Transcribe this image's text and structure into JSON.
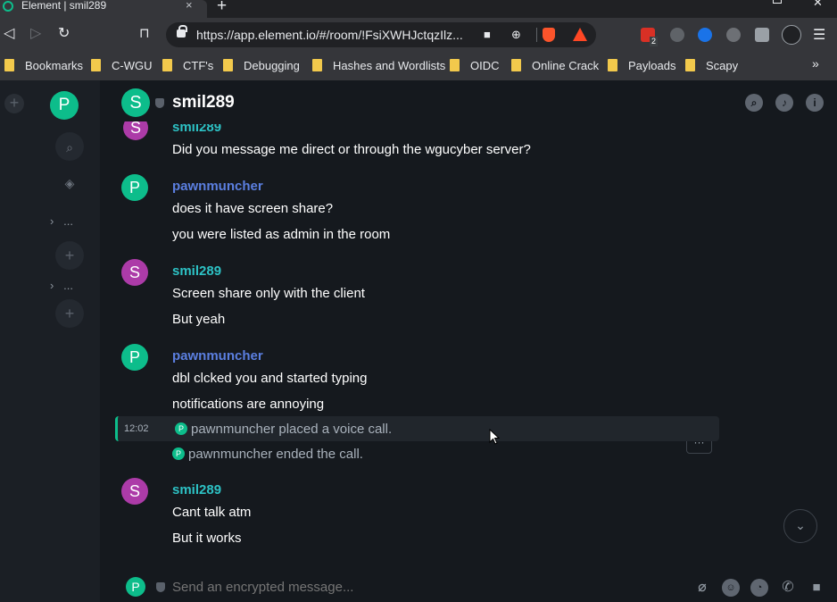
{
  "browser": {
    "tab_title": "Element | smil289",
    "tab_close": "×",
    "new_tab": "+",
    "url": "https://app.element.io/#/room/!FsiXWHJctqzIlz...",
    "extension_badge": "2",
    "bookmarks": [
      "Bookmarks",
      "C-WGU",
      "CTF's",
      "Debugging",
      "Hashes and Wordlists",
      "OIDC",
      "Online Crack",
      "Payloads",
      "Scapy"
    ],
    "bookmarks_overflow": "»"
  },
  "left_panel": {
    "user_initial": "P",
    "sections": [
      "...",
      "..."
    ]
  },
  "room": {
    "initial": "S",
    "name": "smil289"
  },
  "timeline": {
    "partial_sender": "smil289",
    "partial_body": "Did you message me direct or through the wgucyber server?",
    "groups": [
      {
        "initial": "P",
        "sender": "pawnmuncher",
        "lines": [
          "does it have screen share?",
          "you were listed as admin in the room"
        ]
      },
      {
        "initial": "S",
        "sender": "smil289",
        "lines": [
          "Screen share only with the client",
          "But yeah"
        ]
      },
      {
        "initial": "P",
        "sender": "pawnmuncher",
        "lines": [
          "dbl clcked you and started typing",
          "notifications are annoying"
        ]
      },
      {
        "initial": "S",
        "sender": "smil289",
        "lines": [
          "Cant talk atm",
          "But it works"
        ]
      }
    ],
    "call_events": [
      {
        "time": "12:02",
        "initial": "P",
        "text": "pawnmuncher placed a voice call."
      },
      {
        "time": "",
        "initial": "P",
        "text": "pawnmuncher ended the call."
      }
    ],
    "options_label": "···"
  },
  "composer": {
    "user_initial": "P",
    "placeholder": "Send an encrypted message..."
  },
  "colors": {
    "accent": "#0dbd8b",
    "background": "#15191e",
    "sender_smil": "#2dc2c5",
    "sender_pawn": "#5b7fe0",
    "avatar_s": "#ac3ba8"
  }
}
